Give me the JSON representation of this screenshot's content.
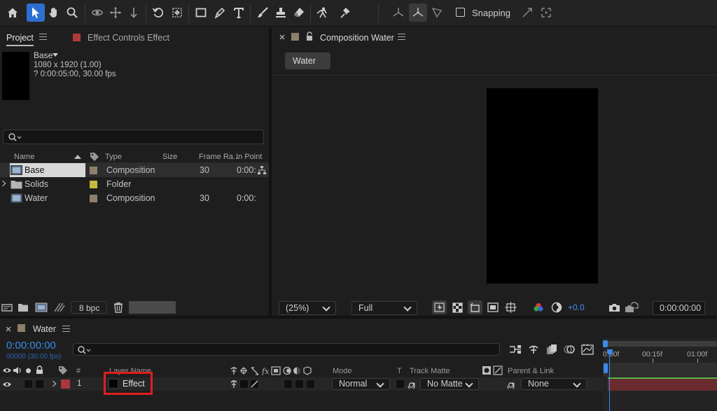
{
  "toolbar": {
    "snapping_label": "Snapping",
    "tools": [
      "home-icon",
      "selection-arrow-icon",
      "hand-icon",
      "zoom-icon",
      "orbit-icon",
      "pan-behind-icon",
      "dolly-icon",
      "rotate-icon",
      "anchor-icon",
      "rectangle-icon",
      "pen-icon",
      "type-icon",
      "brush-icon",
      "clone-stamp-icon",
      "eraser-icon",
      "roto-brush-icon",
      "puppet-pin-icon"
    ]
  },
  "project": {
    "tab_label": "Project",
    "effect_controls_label": "Effect Controls Effect",
    "info_name": "Base",
    "info_dims": "1080 x 1920 (1.00)",
    "info_duration": "? 0:00:05:00, 30.00 fps",
    "columns": {
      "name": "Name",
      "type": "Type",
      "size": "Size",
      "frame_rate": "Frame Ra...",
      "in_point": "In Point"
    },
    "rows": [
      {
        "name": "Base",
        "type": "Composition",
        "frame_rate": "30",
        "in_point": "0:00:"
      },
      {
        "name": "Solids",
        "type": "Folder",
        "frame_rate": "",
        "in_point": ""
      },
      {
        "name": "Water",
        "type": "Composition",
        "frame_rate": "30",
        "in_point": "0:00:"
      }
    ],
    "bpc_label": "8 bpc"
  },
  "composition": {
    "tab_label": "Composition Water",
    "breadcrumb": "Water",
    "zoom": "(25%)",
    "resolution": "Full",
    "exposure": "+0.0",
    "timecode": "0:00:00:00"
  },
  "timeline": {
    "tab_label": "Water",
    "timecode": "0:00:00:00",
    "frames": "00000 (30.00 fps)",
    "ruler": [
      "0:00f",
      "00:15f",
      "01:00f"
    ],
    "headers": {
      "hash": "#",
      "layer_name": "Layer Name",
      "mode": "Mode",
      "t": "T",
      "track_matte": "Track Matte",
      "parent_link": "Parent & Link"
    },
    "layer": {
      "number": "1",
      "name": "Effect",
      "mode": "Normal",
      "track_matte": "No Matte",
      "parent": "None"
    }
  },
  "colors": {
    "accent": "#2d6fd1",
    "composition_label": "#8e7f6a",
    "folder_label": "#c7b93a",
    "layer_label": "#a8383d",
    "effect_controls_swatch": "#b33a3a",
    "highlight_box": "#e01d1d",
    "work_area_bar": "#6a2a2e"
  }
}
